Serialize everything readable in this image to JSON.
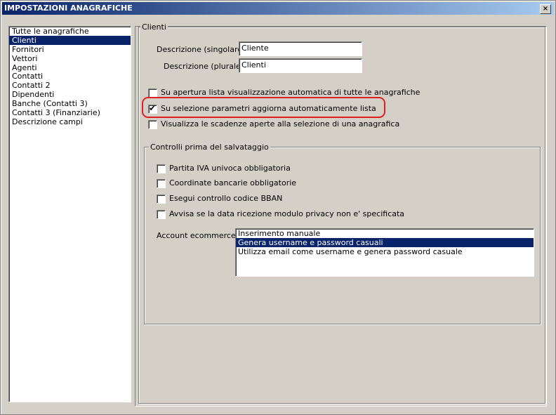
{
  "window": {
    "title": "IMPOSTAZIONI ANAGRAFICHE",
    "close": "×"
  },
  "sidebar": {
    "items": [
      {
        "label": "Tutte le anagrafiche",
        "selected": false
      },
      {
        "label": "Clienti",
        "selected": true
      },
      {
        "label": "Fornitori",
        "selected": false
      },
      {
        "label": "Vettori",
        "selected": false
      },
      {
        "label": "Agenti",
        "selected": false
      },
      {
        "label": "Contatti",
        "selected": false
      },
      {
        "label": "Contatti 2",
        "selected": false
      },
      {
        "label": "Dipendenti",
        "selected": false
      },
      {
        "label": "Banche (Contatti 3)",
        "selected": false
      },
      {
        "label": "Contatti 3 (Finanziarie)",
        "selected": false
      },
      {
        "label": "Descrizione campi",
        "selected": false
      }
    ]
  },
  "clienti": {
    "group_title": "Clienti",
    "desc_singolare_label": "Descrizione (singolare) :",
    "desc_singolare_value": "Cliente",
    "desc_plurale_label": "Descrizione (plurale) :",
    "desc_plurale_value": "Clienti",
    "options": [
      {
        "label": "Su apertura lista visualizzazione automatica di tutte le anagrafiche",
        "checked": false
      },
      {
        "label": "Su selezione parametri aggiorna automaticamente lista",
        "checked": true
      },
      {
        "label": "Visualizza le scadenze aperte alla selezione di una anagrafica",
        "checked": false
      }
    ]
  },
  "controlli": {
    "group_title": "Controlli prima del salvataggio",
    "options": [
      {
        "label": "Partita IVA univoca obbligatoria",
        "checked": false
      },
      {
        "label": "Coordinate bancarie obbligatorie",
        "checked": false
      },
      {
        "label": "Esegui controllo codice BBAN",
        "checked": false
      },
      {
        "label": "Avvisa se la data ricezione modulo privacy non e' specificata",
        "checked": false
      }
    ],
    "ecommerce_label": "Account ecommerce :",
    "ecommerce_options": [
      {
        "label": "Inserimento manuale",
        "selected": false
      },
      {
        "label": "Genera username e password casuali",
        "selected": true
      },
      {
        "label": "Utilizza email come username e genera password casuale",
        "selected": false
      }
    ]
  },
  "colors": {
    "selection": "#0a246a",
    "highlight": "#e02020",
    "face": "#d4d0c8"
  }
}
